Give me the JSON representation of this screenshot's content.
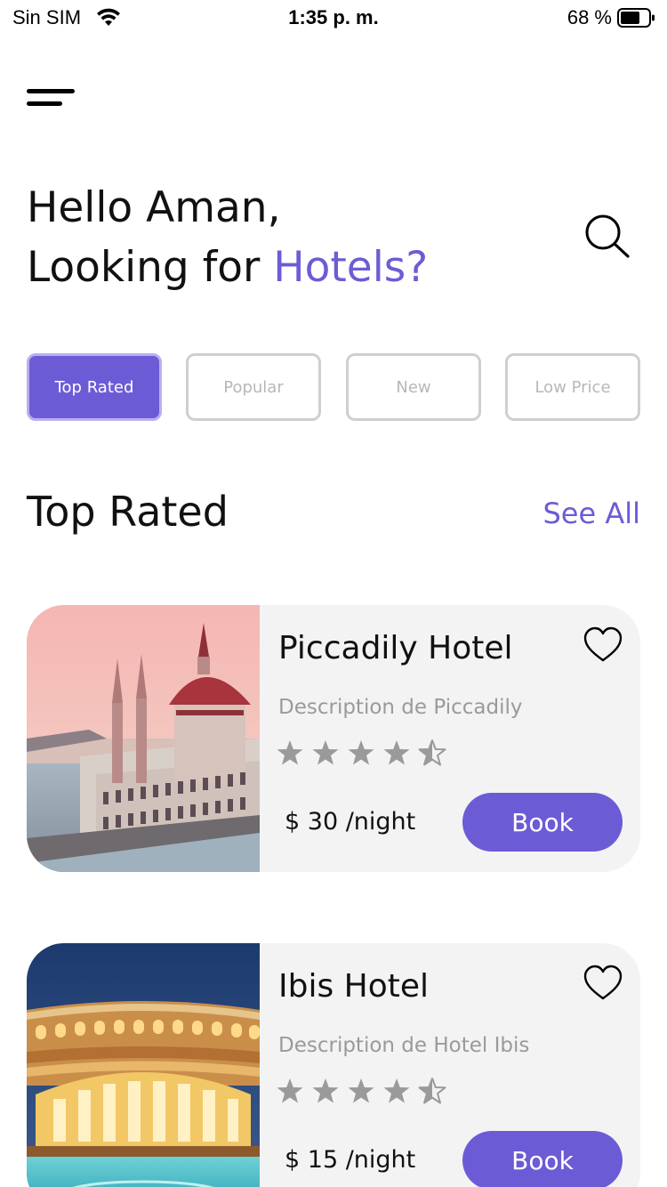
{
  "status_bar": {
    "carrier": "Sin SIM",
    "time": "1:35 p. m.",
    "battery_percent": "68 %"
  },
  "greeting": {
    "line1": "Hello Aman,",
    "line2_prefix": "Looking for ",
    "line2_highlight": "Hotels?"
  },
  "filters": [
    {
      "label": "Top Rated",
      "active": true
    },
    {
      "label": "Popular",
      "active": false
    },
    {
      "label": "New",
      "active": false
    },
    {
      "label": "Low Price",
      "active": false
    }
  ],
  "section": {
    "title": "Top Rated",
    "see_all": "See All"
  },
  "hotels": [
    {
      "name": "Piccadily Hotel",
      "description": "Description de Piccadily",
      "rating": 4.5,
      "price": "$ 30 /night",
      "book_label": "Book"
    },
    {
      "name": "Ibis Hotel",
      "description": "Description de Hotel Ibis",
      "rating": 4.5,
      "price": "$ 15 /night",
      "book_label": "Book"
    }
  ],
  "colors": {
    "accent": "#6b5cd6",
    "card_bg": "#f3f3f3",
    "star": "#9a9a9a",
    "muted_text": "#9a9a9a"
  },
  "icons": {
    "menu": "menu-icon",
    "search": "search-icon",
    "favorite": "heart-icon",
    "star": "star-icon"
  }
}
